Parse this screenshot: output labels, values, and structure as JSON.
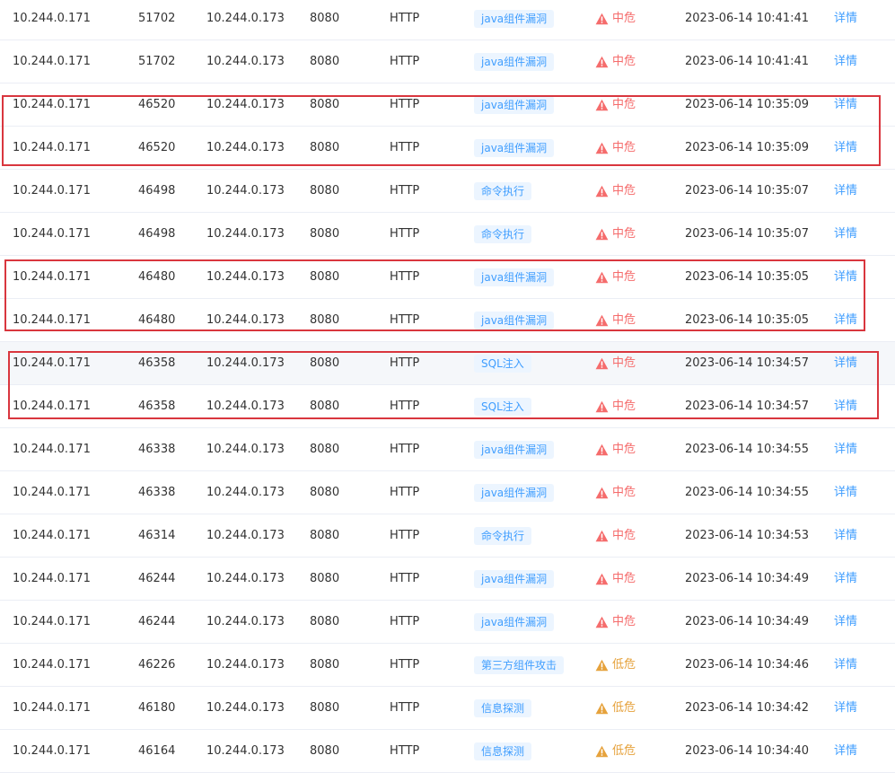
{
  "colors": {
    "tag_bg": "#ecf5ff",
    "tag_text": "#409eff",
    "medium_risk": "#f56c6c",
    "low_risk": "#e6a23c",
    "link": "#409eff",
    "highlight_box": "#d9363e"
  },
  "table": {
    "action_label": "详情",
    "rows": [
      {
        "src_ip": "10.244.0.171",
        "src_port": "51702",
        "dst_ip": "10.244.0.173",
        "dst_port": "8080",
        "protocol": "HTTP",
        "attack_type": "java组件漏洞",
        "risk_level": "中危",
        "severity": "medium",
        "time": "2023-06-14 10:41:41",
        "action": "详情"
      },
      {
        "src_ip": "10.244.0.171",
        "src_port": "51702",
        "dst_ip": "10.244.0.173",
        "dst_port": "8080",
        "protocol": "HTTP",
        "attack_type": "java组件漏洞",
        "risk_level": "中危",
        "severity": "medium",
        "time": "2023-06-14 10:41:41",
        "action": "详情"
      },
      {
        "src_ip": "10.244.0.171",
        "src_port": "46520",
        "dst_ip": "10.244.0.173",
        "dst_port": "8080",
        "protocol": "HTTP",
        "attack_type": "java组件漏洞",
        "risk_level": "中危",
        "severity": "medium",
        "time": "2023-06-14 10:35:09",
        "action": "详情"
      },
      {
        "src_ip": "10.244.0.171",
        "src_port": "46520",
        "dst_ip": "10.244.0.173",
        "dst_port": "8080",
        "protocol": "HTTP",
        "attack_type": "java组件漏洞",
        "risk_level": "中危",
        "severity": "medium",
        "time": "2023-06-14 10:35:09",
        "action": "详情"
      },
      {
        "src_ip": "10.244.0.171",
        "src_port": "46498",
        "dst_ip": "10.244.0.173",
        "dst_port": "8080",
        "protocol": "HTTP",
        "attack_type": "命令执行",
        "risk_level": "中危",
        "severity": "medium",
        "time": "2023-06-14 10:35:07",
        "action": "详情"
      },
      {
        "src_ip": "10.244.0.171",
        "src_port": "46498",
        "dst_ip": "10.244.0.173",
        "dst_port": "8080",
        "protocol": "HTTP",
        "attack_type": "命令执行",
        "risk_level": "中危",
        "severity": "medium",
        "time": "2023-06-14 10:35:07",
        "action": "详情"
      },
      {
        "src_ip": "10.244.0.171",
        "src_port": "46480",
        "dst_ip": "10.244.0.173",
        "dst_port": "8080",
        "protocol": "HTTP",
        "attack_type": "java组件漏洞",
        "risk_level": "中危",
        "severity": "medium",
        "time": "2023-06-14 10:35:05",
        "action": "详情"
      },
      {
        "src_ip": "10.244.0.171",
        "src_port": "46480",
        "dst_ip": "10.244.0.173",
        "dst_port": "8080",
        "protocol": "HTTP",
        "attack_type": "java组件漏洞",
        "risk_level": "中危",
        "severity": "medium",
        "time": "2023-06-14 10:35:05",
        "action": "详情"
      },
      {
        "src_ip": "10.244.0.171",
        "src_port": "46358",
        "dst_ip": "10.244.0.173",
        "dst_port": "8080",
        "protocol": "HTTP",
        "attack_type": "SQL注入",
        "risk_level": "中危",
        "severity": "medium",
        "time": "2023-06-14 10:34:57",
        "action": "详情"
      },
      {
        "src_ip": "10.244.0.171",
        "src_port": "46358",
        "dst_ip": "10.244.0.173",
        "dst_port": "8080",
        "protocol": "HTTP",
        "attack_type": "SQL注入",
        "risk_level": "中危",
        "severity": "medium",
        "time": "2023-06-14 10:34:57",
        "action": "详情"
      },
      {
        "src_ip": "10.244.0.171",
        "src_port": "46338",
        "dst_ip": "10.244.0.173",
        "dst_port": "8080",
        "protocol": "HTTP",
        "attack_type": "java组件漏洞",
        "risk_level": "中危",
        "severity": "medium",
        "time": "2023-06-14 10:34:55",
        "action": "详情"
      },
      {
        "src_ip": "10.244.0.171",
        "src_port": "46338",
        "dst_ip": "10.244.0.173",
        "dst_port": "8080",
        "protocol": "HTTP",
        "attack_type": "java组件漏洞",
        "risk_level": "中危",
        "severity": "medium",
        "time": "2023-06-14 10:34:55",
        "action": "详情"
      },
      {
        "src_ip": "10.244.0.171",
        "src_port": "46314",
        "dst_ip": "10.244.0.173",
        "dst_port": "8080",
        "protocol": "HTTP",
        "attack_type": "命令执行",
        "risk_level": "中危",
        "severity": "medium",
        "time": "2023-06-14 10:34:53",
        "action": "详情"
      },
      {
        "src_ip": "10.244.0.171",
        "src_port": "46244",
        "dst_ip": "10.244.0.173",
        "dst_port": "8080",
        "protocol": "HTTP",
        "attack_type": "java组件漏洞",
        "risk_level": "中危",
        "severity": "medium",
        "time": "2023-06-14 10:34:49",
        "action": "详情"
      },
      {
        "src_ip": "10.244.0.171",
        "src_port": "46244",
        "dst_ip": "10.244.0.173",
        "dst_port": "8080",
        "protocol": "HTTP",
        "attack_type": "java组件漏洞",
        "risk_level": "中危",
        "severity": "medium",
        "time": "2023-06-14 10:34:49",
        "action": "详情"
      },
      {
        "src_ip": "10.244.0.171",
        "src_port": "46226",
        "dst_ip": "10.244.0.173",
        "dst_port": "8080",
        "protocol": "HTTP",
        "attack_type": "第三方组件攻击",
        "risk_level": "低危",
        "severity": "low",
        "time": "2023-06-14 10:34:46",
        "action": "详情"
      },
      {
        "src_ip": "10.244.0.171",
        "src_port": "46180",
        "dst_ip": "10.244.0.173",
        "dst_port": "8080",
        "protocol": "HTTP",
        "attack_type": "信息探测",
        "risk_level": "低危",
        "severity": "low",
        "time": "2023-06-14 10:34:42",
        "action": "详情"
      },
      {
        "src_ip": "10.244.0.171",
        "src_port": "46164",
        "dst_ip": "10.244.0.173",
        "dst_port": "8080",
        "protocol": "HTTP",
        "attack_type": "信息探测",
        "risk_level": "低危",
        "severity": "low",
        "time": "2023-06-14 10:34:40",
        "action": "详情"
      }
    ]
  }
}
